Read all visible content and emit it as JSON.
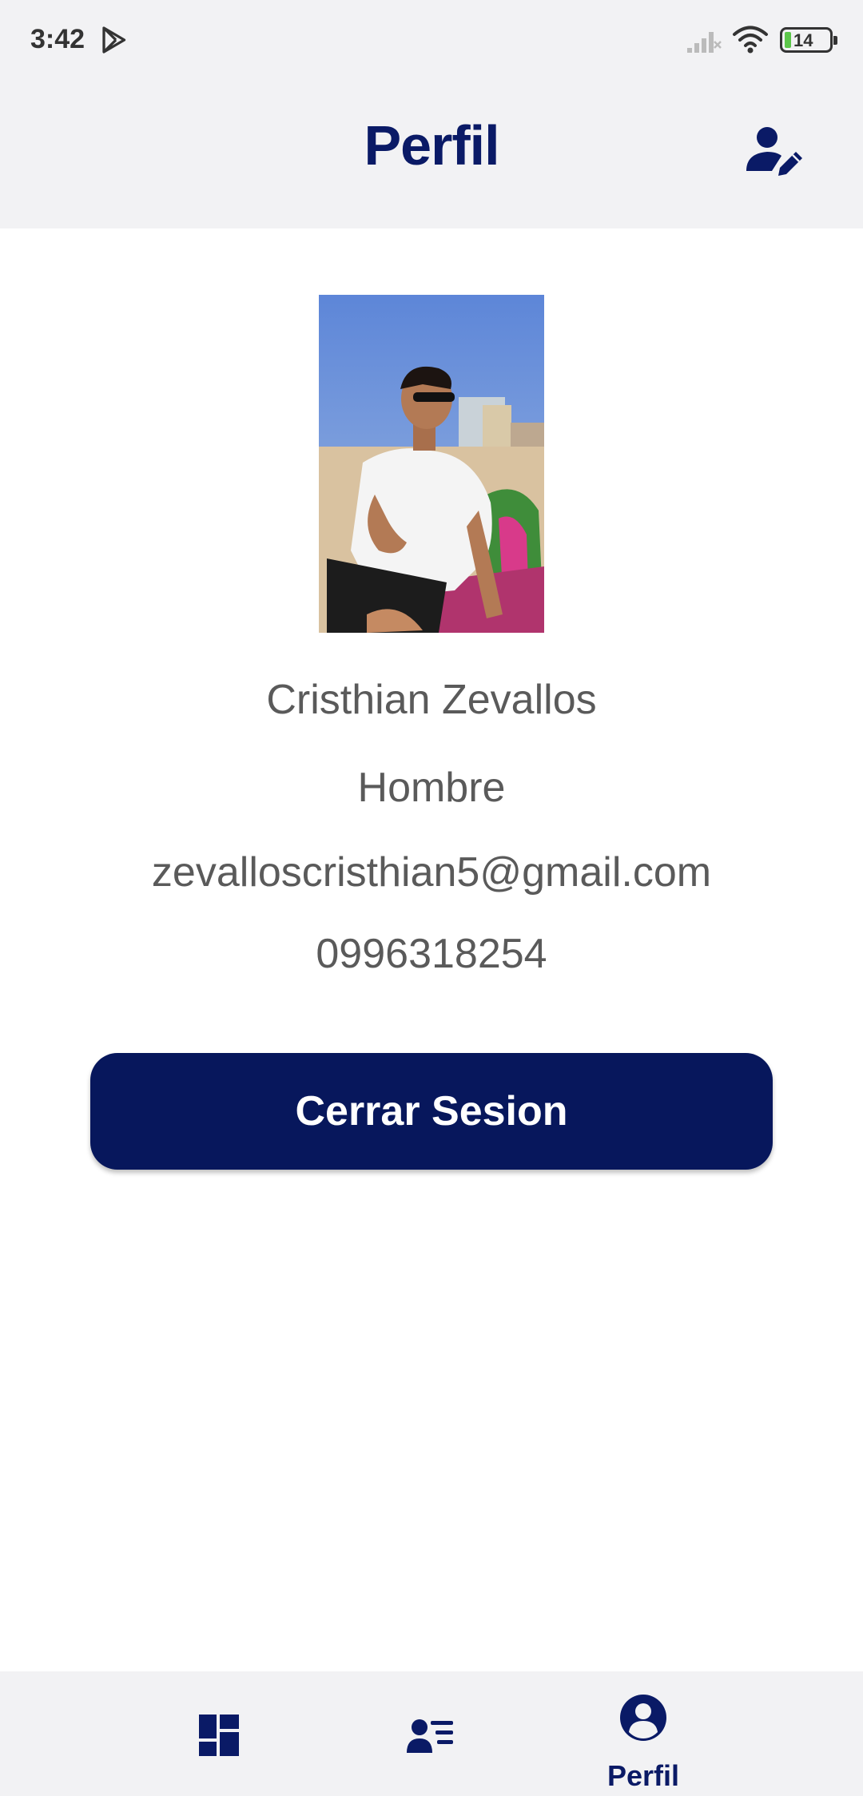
{
  "status_bar": {
    "time": "3:42",
    "battery": "14"
  },
  "header": {
    "title": "Perfil",
    "edit_icon": "user-pen-icon"
  },
  "profile": {
    "name": "Cristhian Zevallos",
    "gender": "Hombre",
    "email": "zevalloscristhian5@gmail.com",
    "phone": "0996318254"
  },
  "actions": {
    "logout_label": "Cerrar Sesion"
  },
  "bottom_nav": {
    "items": [
      {
        "icon": "dashboard-icon",
        "label": ""
      },
      {
        "icon": "user-list-icon",
        "label": ""
      },
      {
        "icon": "account-circle-icon",
        "label": "Perfil"
      }
    ]
  },
  "colors": {
    "primary": "#07175c",
    "title": "#0a1a66",
    "text": "#5a5a5a",
    "bar_bg": "#f2f2f4"
  }
}
